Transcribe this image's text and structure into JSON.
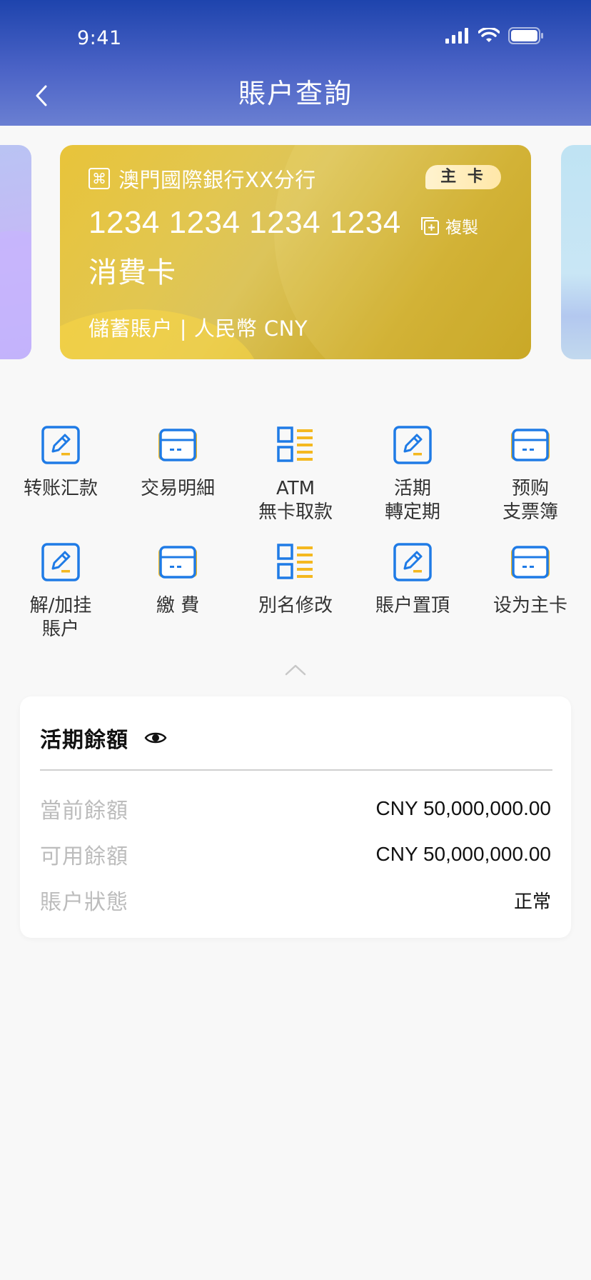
{
  "status_bar": {
    "time": "9:41"
  },
  "nav": {
    "title": "賬户查詢"
  },
  "card": {
    "bank_name": "澳門國際銀行XX分行",
    "badge": "主 卡",
    "number": "1234 1234 1234 1234",
    "copy_label": "複製",
    "card_type": "消費卡",
    "footer": "儲蓄賬户 | 人民幣 CNY"
  },
  "functions": [
    {
      "label": "转账汇款",
      "icon": "edit-icon"
    },
    {
      "label": "交易明細",
      "icon": "card-icon"
    },
    {
      "label": "ATM\n無卡取款",
      "icon": "list-icon"
    },
    {
      "label": "活期\n轉定期",
      "icon": "edit-icon"
    },
    {
      "label": "预购\n支票簿",
      "icon": "card-icon"
    },
    {
      "label": "解/加挂\n賬户",
      "icon": "edit-icon"
    },
    {
      "label": "繳 費",
      "icon": "card-icon"
    },
    {
      "label": "別名修改",
      "icon": "list-icon"
    },
    {
      "label": "賬户置頂",
      "icon": "edit-icon"
    },
    {
      "label": "设为主卡",
      "icon": "card-icon"
    }
  ],
  "balance": {
    "title": "活期餘額",
    "rows": [
      {
        "label": "當前餘額",
        "value": "CNY 50,000,000.00"
      },
      {
        "label": "可用餘額",
        "value": "CNY 50,000,000.00"
      },
      {
        "label": "賬户狀態",
        "value": "正常"
      }
    ]
  },
  "colors": {
    "header_top": "#1e44ad",
    "header_bottom": "#6a7fd2",
    "icon_blue": "#1f7be6",
    "icon_yellow": "#f4b81f",
    "card_gold": "#d8b83a"
  }
}
